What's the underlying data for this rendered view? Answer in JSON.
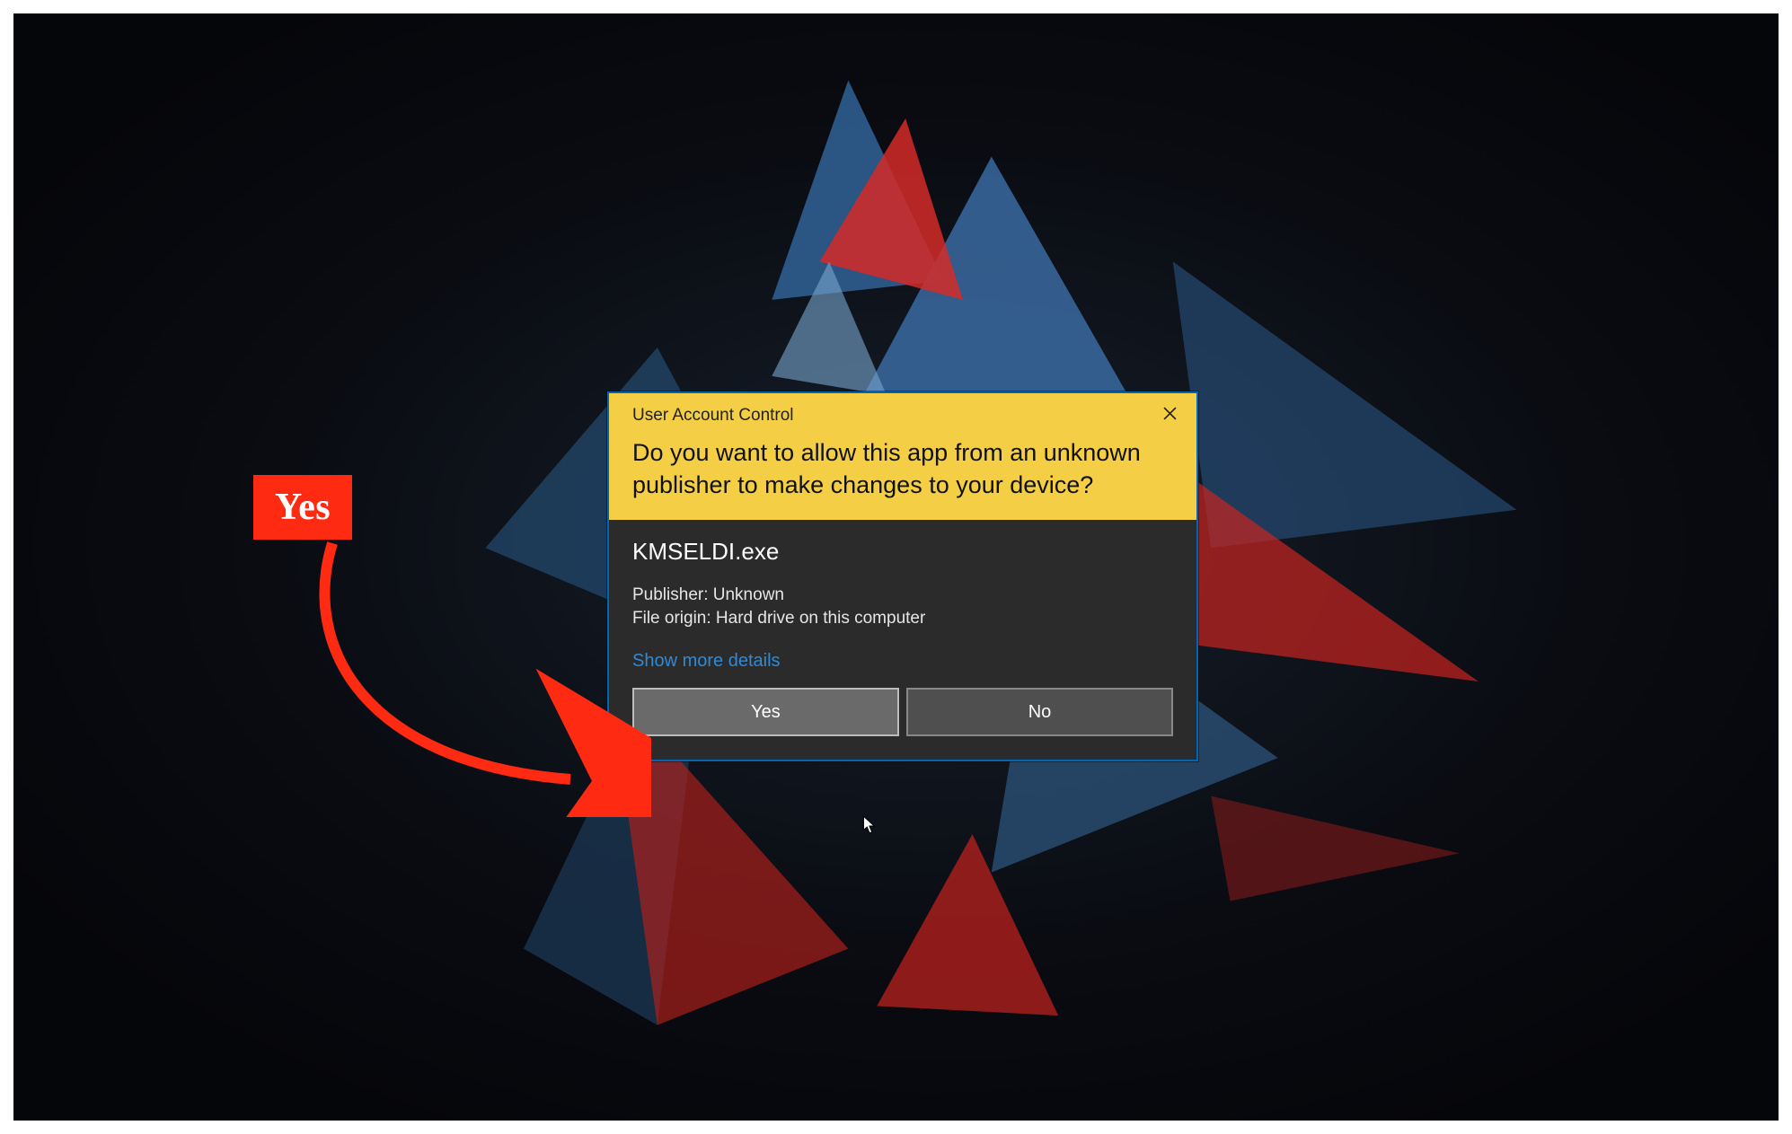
{
  "annotation": {
    "badge_text": "Yes"
  },
  "uac": {
    "title": "User Account Control",
    "question": "Do you want to allow this app from an unknown publisher to make changes to your device?",
    "app_name": "KMSELDI.exe",
    "publisher_line": "Publisher: Unknown",
    "origin_line": "File origin: Hard drive on this computer",
    "show_more": "Show more details",
    "yes_label": "Yes",
    "no_label": "No"
  },
  "colors": {
    "header_yellow": "#f4cf46",
    "dialog_border": "#0066b3",
    "badge_red": "#ff2a12",
    "link_blue": "#2f8ad8"
  }
}
